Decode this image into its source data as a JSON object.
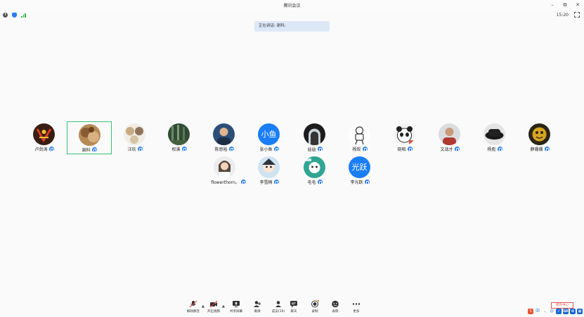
{
  "window": {
    "title": "腾讯会议",
    "minimize": "–",
    "restore": "⧉",
    "close": "✕"
  },
  "status": {
    "time": "15:20"
  },
  "banner": {
    "text": "正在讲话: 谢科;"
  },
  "participants": [
    {
      "name": "卢剑涛",
      "avatar": "photo-red"
    },
    {
      "name": "谢科",
      "avatar": "photo-cat",
      "selected": true
    },
    {
      "name": "汪玖",
      "avatar": "photo-cats"
    },
    {
      "name": "权溪",
      "avatar": "photo-forest"
    },
    {
      "name": "陈思裕",
      "avatar": "photo-person"
    },
    {
      "name": "张小鱼",
      "avatar_text": "小鱼"
    },
    {
      "name": "益益",
      "avatar": "photo-arch"
    },
    {
      "name": "杨玫",
      "avatar": "photo-robot"
    },
    {
      "name": "晓昭",
      "avatar": "photo-panda"
    },
    {
      "name": "文战才",
      "avatar": "photo-man"
    },
    {
      "name": "杨彪",
      "avatar": "photo-hat"
    },
    {
      "name": "薛珊珊",
      "avatar": "photo-yellow"
    },
    {
      "name": "flowerthorn。",
      "avatar": "photo-girl"
    },
    {
      "name": "李雪楠",
      "avatar": "photo-anime"
    },
    {
      "name": "毛毛",
      "avatar": "photo-teal"
    },
    {
      "name": "李光跃",
      "avatar_text": "光跃"
    }
  ],
  "toolbar": {
    "mute": "解除静音",
    "video": "开启视频",
    "share": "共享屏幕",
    "invite": "邀请",
    "members": "成员(16)",
    "chat": "聊天",
    "record": "录制",
    "emoji": "表情",
    "more": "更多"
  },
  "tray": {
    "ime": "中",
    "reminder": "提升中心"
  },
  "colors": {
    "accent": "#2a7ef5",
    "selected_border": "#38c173",
    "banner_bg": "#dde8f7"
  }
}
